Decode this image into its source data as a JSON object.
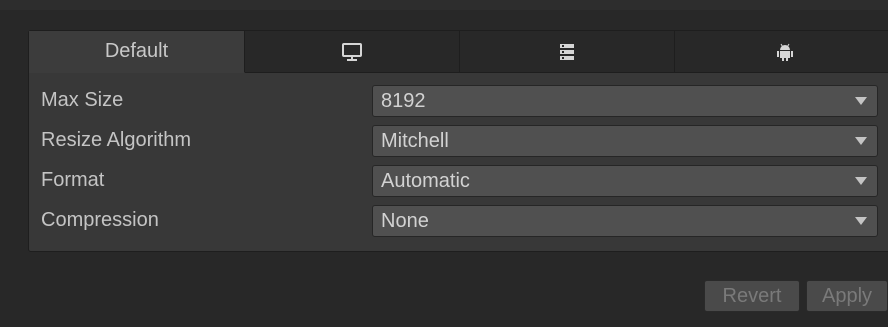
{
  "tabs": [
    {
      "label": "Default",
      "icon": null
    },
    {
      "label": "",
      "icon": "monitor-icon"
    },
    {
      "label": "",
      "icon": "server-icon"
    },
    {
      "label": "",
      "icon": "android-icon"
    }
  ],
  "settings": {
    "max_size": {
      "label": "Max Size",
      "value": "8192"
    },
    "resize_algorithm": {
      "label": "Resize Algorithm",
      "value": "Mitchell"
    },
    "format": {
      "label": "Format",
      "value": "Automatic"
    },
    "compression": {
      "label": "Compression",
      "value": "None"
    }
  },
  "buttons": {
    "revert": "Revert",
    "apply": "Apply"
  },
  "colors": {
    "background": "#282828",
    "panel": "#383838",
    "dropdown": "#505050",
    "text": "#c4c4c4",
    "disabled_text": "#7a7a7a"
  }
}
